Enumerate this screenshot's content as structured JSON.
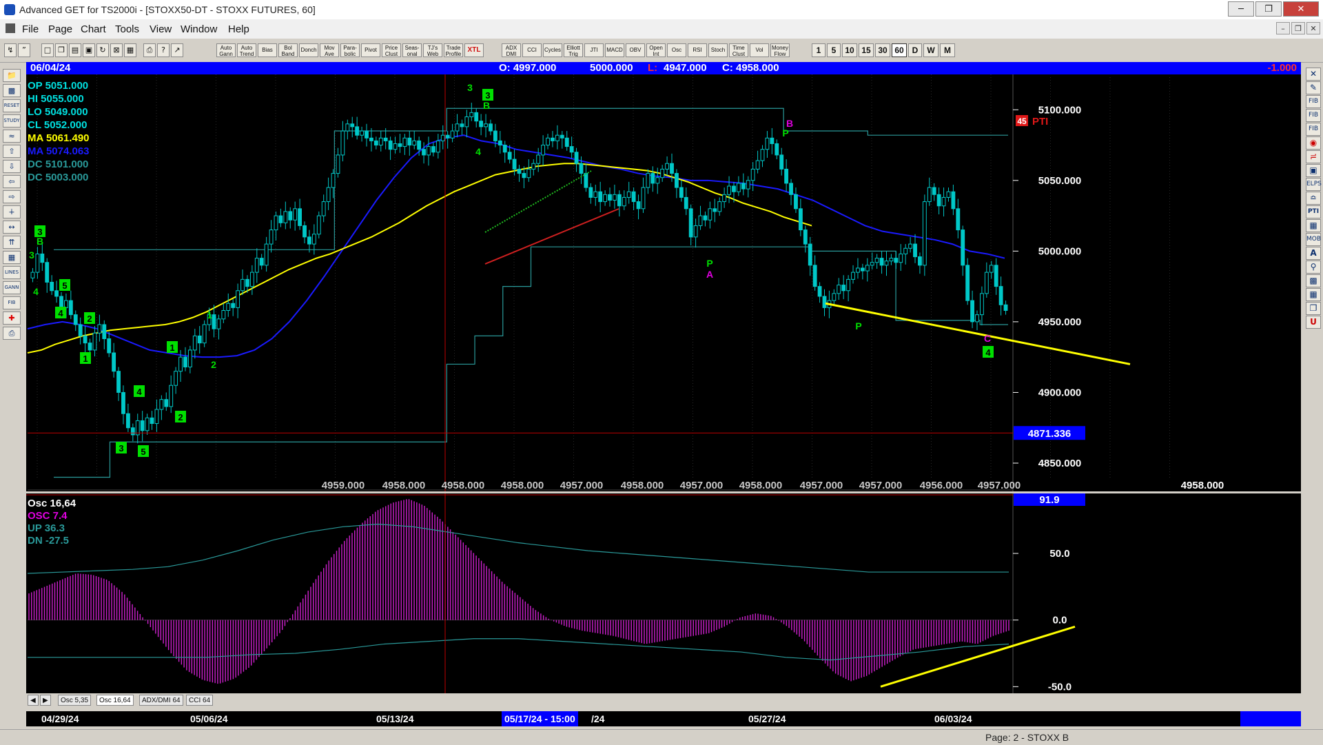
{
  "window": {
    "title": "Advanced GET for TS2000i - [STOXX50-DT - STOXX FUTURES, 60]",
    "minimize": "─",
    "restore": "❐",
    "close": "✕"
  },
  "menu": {
    "items": [
      "File",
      "Page",
      "Chart",
      "Tools",
      "View",
      "Window",
      "Help"
    ],
    "mdi_minimize": "–",
    "mdi_restore": "❐",
    "mdi_close": "✕"
  },
  "toolbar": {
    "study_buttons": [
      "Auto Gann",
      "Auto Trend",
      "Bias",
      "Bol Band",
      "Donch",
      "Mov Ave",
      "Para-bolic",
      "Pivot",
      "Price Clust",
      "Seas-onal",
      "TJ's Web",
      "Trade Profile",
      "XTL",
      "ADX DMI",
      "CCI",
      "Cycles",
      "Elliott Trig",
      "JTI",
      "MACD",
      "OBV",
      "Open Int",
      "Osc",
      "RSI",
      "Stoch",
      "Time Clust",
      "Vol",
      "Money Flow"
    ],
    "periods": [
      "1",
      "5",
      "10",
      "15",
      "30",
      "60",
      "D",
      "W",
      "M"
    ],
    "selected_period": "60"
  },
  "left_tools": [
    "OPEN",
    "SAVE",
    "RESET",
    "STUDY",
    "ELLIOTT",
    "UP",
    "DOWN",
    "LEFT",
    "RIGHT",
    "ZOOM",
    "FIT",
    "ZOOMO",
    "GRID",
    "LINES",
    "GANN",
    "FIB",
    "CROSS",
    "PRINT"
  ],
  "right_tools": [
    "CLOSE",
    "PENCIL",
    "FIB RET",
    "FIB EXT",
    "FIB TIME",
    "CIRC",
    "FAN",
    "SQR",
    "ELPS",
    "GANN",
    "PTI",
    "GRID",
    "MOB",
    "A",
    "ZOOM",
    "PAINT",
    "CALC",
    "PG",
    "U"
  ],
  "header": {
    "date": "06/04/24",
    "open": "O: 4997.000",
    "high": "5000.000",
    "low_label": "L:",
    "low": "4947.000",
    "close": "C: 4958.000",
    "change": "-1.000"
  },
  "price_info": {
    "op": "OP  5051.000",
    "hi": "HI    5055.000",
    "lo": "LO   5049.000",
    "cl": "CL   5052.000",
    "ma_yellow": "MA  5061.490",
    "ma_blue": "MA  5074.063",
    "dc_high": "DC  5101.000",
    "dc_low": "DC  5003.000"
  },
  "price_axis": {
    "ticks": [
      "5100.000",
      "5050.000",
      "5000.000",
      "4950.000",
      "4900.000",
      "4850.000"
    ],
    "crosshair_value": "4871.336"
  },
  "bottom_price_row": [
    "4959.000",
    "4958.000",
    "4958.000",
    "4958.000",
    "4957.000",
    "4958.000",
    "4957.000",
    "4958.000",
    "4957.000",
    "4957.000",
    "4956.000",
    "4957.000",
    "4958.000",
    "4957.000",
    "4958.000"
  ],
  "elliott_labels": {
    "left": [
      "3",
      "B",
      "3",
      "4",
      "5",
      "4",
      "2",
      "1",
      "4",
      "3",
      "5",
      "2",
      "1",
      "1",
      "2"
    ],
    "top": [
      "3",
      "3",
      "B",
      "4"
    ],
    "pattern": [
      "P",
      "A",
      "P",
      "B",
      "P",
      "C",
      "4"
    ],
    "pti": "45",
    "pti_label": "PTI"
  },
  "oscillator": {
    "title": "Osc 16,64",
    "osc": "OSC 7.4",
    "up": "UP    36.3",
    "dn": "DN    -27.5",
    "value_box": "91.9",
    "ticks": [
      "50.0",
      "0.0",
      "-50.0"
    ]
  },
  "osc_tabs": [
    "Osc 5,35",
    "Osc 16,64",
    "ADX/DMI 64",
    "CCI 64"
  ],
  "date_axis": {
    "labels": [
      "04/29/24",
      "05/06/24",
      "05/13/24",
      "/24",
      "05/27/24",
      "06/03/24"
    ],
    "crosshair": "05/17/24 - 15:00"
  },
  "status": {
    "page": "Page: 2 - STOXX B"
  },
  "colors": {
    "header_bg": "#0000ff",
    "chart_bg": "#000000",
    "candle": "#00c8c8",
    "ma_yellow": "#ffff00",
    "ma_blue": "#1a1aff",
    "donchian": "#2a9a9a",
    "osc_hist": "#d020d0",
    "crosshair": "#c00000",
    "label_green": "#00e000",
    "label_magenta": "#e000e0"
  },
  "chart_data": {
    "type": "candlestick",
    "symbol": "STOXX50-DT",
    "interval": "60",
    "ylim": [
      4830,
      5125
    ],
    "yticks": [
      5100,
      5050,
      5000,
      4950,
      4900,
      4850
    ],
    "close": [
      4985,
      4998,
      4992,
      4978,
      4972,
      4968,
      4960,
      4965,
      4955,
      4948,
      4940,
      4935,
      4930,
      4942,
      4948,
      4938,
      4928,
      4915,
      4900,
      4885,
      4875,
      4870,
      4880,
      4873,
      4882,
      4878,
      4888,
      4895,
      4890,
      4905,
      4915,
      4925,
      4918,
      4930,
      4940,
      4935,
      4948,
      4955,
      4945,
      4952,
      4958,
      4963,
      4960,
      4972,
      4980,
      4975,
      4985,
      4995,
      4990,
      5005,
      5015,
      5025,
      5020,
      5028,
      5022,
      5030,
      5018,
      5010,
      5005,
      5012,
      5025,
      5035,
      5045,
      5055,
      5068,
      5085,
      5090,
      5088,
      5082,
      5085,
      5080,
      5078,
      5075,
      5080,
      5078,
      5072,
      5076,
      5074,
      5080,
      5075,
      5078,
      5072,
      5068,
      5074,
      5070,
      5078,
      5082,
      5080,
      5085,
      5090,
      5088,
      5095,
      5098,
      5092,
      5088,
      5090,
      5085,
      5078,
      5075,
      5070,
      5065,
      5058,
      5055,
      5052,
      5058,
      5062,
      5068,
      5075,
      5080,
      5078,
      5082,
      5080,
      5074,
      5070,
      5062,
      5055,
      5045,
      5038,
      5042,
      5035,
      5040,
      5036,
      5040,
      5032,
      5038,
      5042,
      5035,
      5030,
      5045,
      5055,
      5048,
      5052,
      5058,
      5062,
      5055,
      5045,
      5038,
      5030,
      5010,
      5018,
      5025,
      5022,
      5030,
      5028,
      5035,
      5040,
      5046,
      5042,
      5048,
      5044,
      5050,
      5058,
      5064,
      5072,
      5080,
      5076,
      5068,
      5058,
      5048,
      5040,
      5030,
      5015,
      5005,
      4990,
      4975,
      4968,
      4960,
      4965,
      4970,
      4976,
      4972,
      4980,
      4985,
      4988,
      4986,
      4990,
      4992,
      4995,
      4990,
      4993,
      4995,
      4992,
      4998,
      5002,
      5005,
      4996,
      4990,
      5035,
      5045,
      5040,
      5032,
      5038,
      5042,
      5030,
      5015,
      4990,
      4965,
      4950,
      4955,
      4970,
      4985,
      4990,
      4975,
      4962,
      4958
    ],
    "ma_yellow": [
      4928,
      4930,
      4934,
      4937,
      4940,
      4942,
      4944,
      4945,
      4946,
      4947,
      4948,
      4950,
      4953,
      4957,
      4962,
      4967,
      4972,
      4977,
      4982,
      4987,
      4991,
      4995,
      4998,
      5002,
      5006,
      5010,
      5015,
      5020,
      5026,
      5032,
      5037,
      5042,
      5046,
      5050,
      5054,
      5056,
      5058,
      5060,
      5061,
      5062,
      5062,
      5061,
      5060,
      5059,
      5058,
      5057,
      5055,
      5052,
      5049,
      5045,
      5041,
      5038,
      5034,
      5031,
      5028,
      5024,
      5021,
      5018
    ],
    "ma_blue": [
      4945,
      4948,
      4950,
      4948,
      4945,
      4940,
      4935,
      4930,
      4928,
      4926,
      4925,
      4925,
      4926,
      4930,
      4938,
      4950,
      4965,
      4982,
      5000,
      5018,
      5036,
      5052,
      5066,
      5076,
      5080,
      5082,
      5078,
      5076,
      5072,
      5070,
      5068,
      5066,
      5063,
      5060,
      5058,
      5055,
      5053,
      5052,
      5050,
      5050,
      5049,
      5048,
      5046,
      5044,
      5040,
      5036,
      5030,
      5024,
      5018,
      5014,
      5012,
      5010,
      5008,
      5005,
      5000,
      4998,
      4995
    ],
    "donchian_upper": [
      5001,
      5001,
      5001,
      5001,
      5001,
      5001,
      5001,
      5001,
      5001,
      5001,
      5085,
      5085,
      5085,
      5085,
      5101,
      5101,
      5101,
      5101,
      5101,
      5101,
      5101,
      5101,
      5101,
      5101,
      5101,
      5101,
      5085,
      5085,
      5085,
      5082,
      5082,
      5082,
      5082,
      5082,
      5082
    ],
    "donchian_lower": [
      4840,
      4840,
      4865,
      4865,
      4865,
      4865,
      4865,
      4865,
      4865,
      4865,
      4865,
      4865,
      4865,
      4865,
      4920,
      4940,
      4975,
      5003,
      5003,
      5003,
      5003,
      5003,
      5003,
      5003,
      5003,
      5003,
      5003,
      5000,
      5000,
      5000,
      4951,
      4951,
      4951,
      4948,
      4948
    ],
    "osc": [
      20,
      25,
      30,
      35,
      34,
      30,
      20,
      5,
      -10,
      -25,
      -38,
      -45,
      -48,
      -44,
      -35,
      -22,
      -8,
      10,
      28,
      45,
      60,
      72,
      82,
      88,
      91,
      86,
      76,
      64,
      52,
      40,
      28,
      18,
      8,
      0,
      -5,
      -8,
      -10,
      -12,
      -15,
      -18,
      -16,
      -14,
      -12,
      -10,
      -5,
      2,
      5,
      3,
      -5,
      -15,
      -28,
      -40,
      -46,
      -42,
      -35,
      -28,
      -22,
      -20,
      -18,
      -16,
      -18,
      -12,
      -8
    ],
    "osc_up": [
      35,
      36,
      37,
      38,
      40,
      45,
      52,
      60,
      66,
      70,
      72,
      70,
      66,
      62,
      58,
      55,
      52,
      50,
      48,
      46,
      44,
      42,
      40,
      38,
      36,
      36,
      36,
      36,
      36
    ],
    "osc_dn": [
      -28,
      -28,
      -28,
      -28,
      -28,
      -26,
      -25,
      -22,
      -18,
      -16,
      -14,
      -14,
      -16,
      -18,
      -20,
      -22,
      -24,
      -28,
      -30,
      -27,
      -24,
      -20,
      -18
    ],
    "osc_ylim": [
      -55,
      95
    ],
    "osc_yticks": [
      50,
      0,
      -50
    ]
  }
}
